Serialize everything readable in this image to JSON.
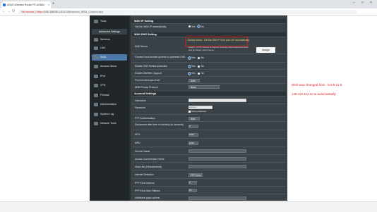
{
  "browser": {
    "tab_title": "ASUS Wireless Router RT-AX86U",
    "new_tab_symbol": "+",
    "window_controls": [
      "–",
      "□",
      "×"
    ],
    "url_scheme_label": "Not secure",
    "url_scheme": "https://",
    "url_host": "192.168.50.1",
    "url_path": ":8443/Advanced_WAN_Content.asp",
    "nav": [
      "←",
      "→",
      "↻"
    ]
  },
  "sidebar": {
    "top_item": "Tools",
    "header": "Advanced Settings",
    "items": [
      {
        "label": "Wireless",
        "icon": "wireless-icon"
      },
      {
        "label": "LAN",
        "icon": "lan-icon"
      },
      {
        "label": "WAN",
        "icon": "wan-icon"
      },
      {
        "label": "Amazon Alexa",
        "icon": "alexa-icon"
      },
      {
        "label": "IPv6",
        "icon": "ipv6-icon"
      },
      {
        "label": "VPN",
        "icon": "vpn-icon"
      },
      {
        "label": "Firewall",
        "icon": "firewall-icon"
      },
      {
        "label": "Administration",
        "icon": "administration-icon"
      },
      {
        "label": "System Log",
        "icon": "system-log-icon"
      },
      {
        "label": "Network Tools",
        "icon": "network-tools-icon"
      }
    ],
    "active": "WAN"
  },
  "wan_ip": {
    "title": "WAN IP Setting",
    "get_ip_auto_label": "Get the WAN IP automatically",
    "yes": "Yes",
    "no": "No"
  },
  "wan_dns": {
    "title": "WAN DNS Setting",
    "dns_server_label": "DNS Server",
    "default_status": "Default status : Get the DNS IP from your ISP automatically.",
    "assign_hint": "Assign a DNS service to improve security, block advertisements and get faster performance.",
    "assign_button": "Assign",
    "forward_label": "Forward local domain queries to upstream DNS",
    "rebind_label": "Enable DNS Rebind protection",
    "dnssec_label": "Enable DNSSEC support",
    "prevent_doh_label": "Prevent client auto DoH",
    "prevent_doh_value": "Auto",
    "privacy_label": "DNS Privacy Protocol",
    "privacy_value": "None"
  },
  "account": {
    "title": "Account Settings",
    "username_label": "Username",
    "username_value": "",
    "password_label": "Password",
    "password_value": "••••••••••",
    "show_password_label": "Show password",
    "pppoe_auth_label": "PPP Authentication",
    "pppoe_auth_value": "Auto",
    "disconnect_label": "Disconnect after time of inactivity (in seconds)",
    "disconnect_value": "0",
    "mtu_label": "MTU",
    "mtu_value": "1492",
    "mru_label": "MRU",
    "mru_value": "1492",
    "service_label": "Service Name",
    "ac_name_label": "Access Concentrator Name",
    "host_uniq_label": "Host-Uniq (Hexadecimal)",
    "internet_detection_label": "Internet Detection",
    "internet_detection_value": "PPP Echo",
    "echo_interval_label": "PPP Echo Interval",
    "echo_interval_value": "6",
    "echo_failures_label": "PPP Echo Max Failures",
    "echo_failures_value": "10",
    "additional_label": "Additional pppd options"
  },
  "annotation": {
    "line1": "DNS was changed from : 9.9.9.11 &",
    "line2": "149.112.112.11 to automatically"
  },
  "colors": {
    "router_bg": "#2b3034",
    "accent_blue": "#4d7aa8",
    "highlight_red": "#e0201f"
  }
}
